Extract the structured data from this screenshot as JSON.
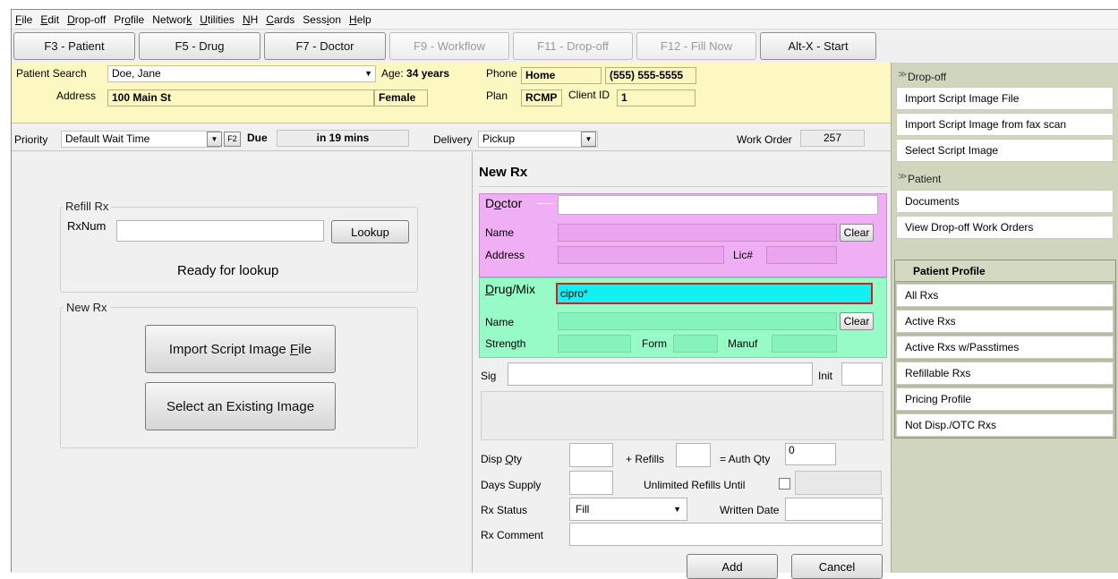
{
  "menu": [
    {
      "pre": "",
      "u": "F",
      "post": "ile"
    },
    {
      "pre": "",
      "u": "E",
      "post": "dit"
    },
    {
      "pre": "",
      "u": "D",
      "post": "rop-off"
    },
    {
      "pre": "Pr",
      "u": "o",
      "post": "file"
    },
    {
      "pre": "Networ",
      "u": "k",
      "post": ""
    },
    {
      "pre": "",
      "u": "U",
      "post": "tilities"
    },
    {
      "pre": "",
      "u": "N",
      "post": "H"
    },
    {
      "pre": "",
      "u": "C",
      "post": "ards"
    },
    {
      "pre": "Sess",
      "u": "i",
      "post": "on"
    },
    {
      "pre": "",
      "u": "H",
      "post": "elp"
    }
  ],
  "toolbar": [
    "F3 - Patient",
    "F5 - Drug",
    "F7 - Doctor",
    "F9 - Workflow",
    "F11 - Drop-off",
    "F12 - Fill Now",
    "Alt-X - Start"
  ],
  "patient": {
    "search_label": "Patient Search",
    "name": "Doe, Jane",
    "age_label": "Age:",
    "age": "34 years",
    "phone_label": "Phone",
    "phone_type": "Home",
    "phone": "(555) 555-5555",
    "address_label": "Address",
    "address": "100 Main St",
    "gender": "Female",
    "plan_label": "Plan",
    "plan": "RCMP",
    "client_id_label": "Client ID",
    "client_id": "1"
  },
  "order": {
    "priority_label": "Priority",
    "priority": "Default Wait Time",
    "f2": "F2",
    "due_label": "Due",
    "due": "in 19 mins",
    "delivery_label": "Delivery",
    "delivery": "Pickup",
    "work_order_label": "Work Order",
    "work_order": "257"
  },
  "refill": {
    "group_title": "Refill Rx",
    "rxnum_label": "RxNum",
    "lookup": "Lookup",
    "status": "Ready for lookup"
  },
  "newrx_left": {
    "group_title": "New Rx",
    "import_pre": "Import Script Image ",
    "import_u": "F",
    "import_post": "ile",
    "select": "Select an Existing Image"
  },
  "rx": {
    "title": "New Rx",
    "doctor_pre": "D",
    "doctor_u": "o",
    "doctor_post": "ctor",
    "name_label": "Name",
    "address_label": "Address",
    "lic_label": "Lic#",
    "clear": "Clear",
    "drug_u": "D",
    "drug_post": "rug/Mix",
    "drug_search": "cipro*",
    "strength_label": "Strength",
    "form_label": "Form",
    "manuf_label": "Manuf",
    "sig_label": "Sig",
    "init_label": "Init",
    "disp_qty_pre": "Disp ",
    "disp_qty_u": "Q",
    "disp_qty_post": "ty",
    "refills_label": "+ Refills",
    "auth_qty_label": "= Auth Qty",
    "auth_qty": "0",
    "days_supply_label": "Days Supply",
    "unlimited_label": "Unlimited Refills Until",
    "rx_status_label": "Rx Status",
    "rx_status": "Fill",
    "written_date_label": "Written Date",
    "comment_label": "Rx Comment",
    "add": "Add",
    "cancel": "Cancel"
  },
  "sidebar": {
    "dropoff_head": "Drop-off",
    "dropoff_items": [
      "Import Script Image File",
      "Import Script Image from fax scan",
      "Select Script Image"
    ],
    "patient_head": "Patient",
    "patient_items": [
      "Documents",
      "View Drop-off Work Orders"
    ],
    "profile_head": "Patient Profile",
    "profile_items": [
      "All Rxs",
      "Active Rxs",
      "Active Rxs w/Passtimes",
      "Refillable Rxs",
      "Pricing Profile",
      "Not Disp./OTC Rxs"
    ]
  },
  "colors": {
    "patient_bg": "#fdf8c2",
    "doctor_bg": "#f0aef4",
    "drug_bg": "#96fbc7",
    "search_highlight": "#12f1f2",
    "highlight_border": "#e01b1b",
    "sidebar_bg": "#d0d6bd"
  }
}
